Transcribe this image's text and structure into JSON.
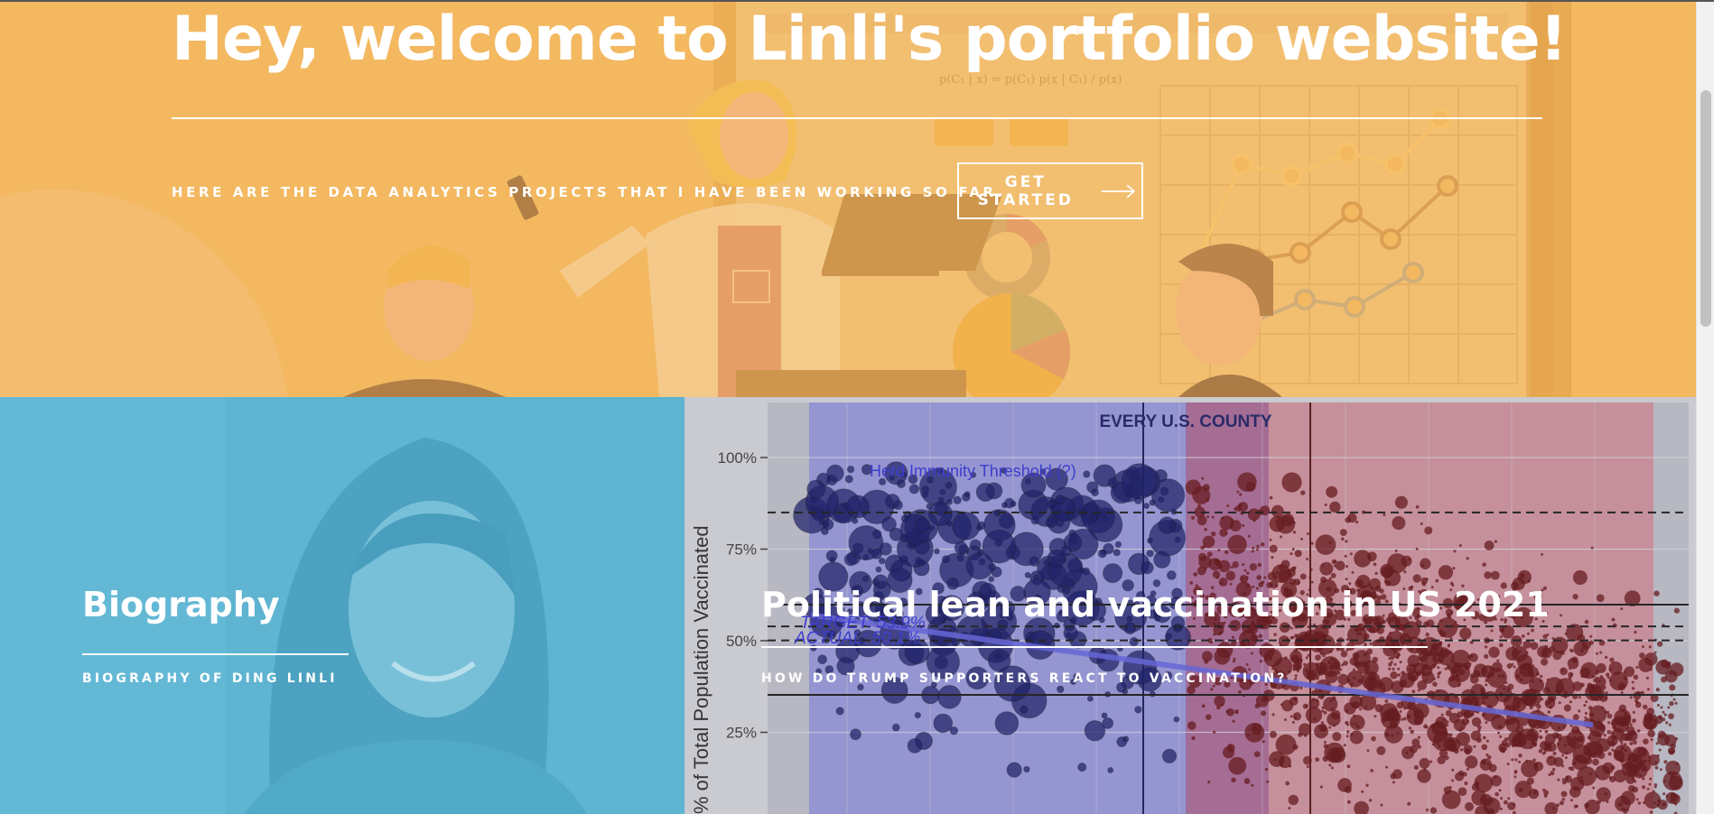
{
  "hero": {
    "title": "Hey, welcome to Linli's portfolio website!",
    "subtitle": "HERE ARE THE DATA ANALYTICS PROJECTS THAT I HAVE BEEN WORKING SO FAR.",
    "cta_label": "GET STARTED",
    "formula_text": "p(C₁ | x) = p(C₁) p(x | C₁) / p(x)",
    "bg_color": "#f2b860"
  },
  "tiles": [
    {
      "title": "Biography",
      "subtitle": "BIOGRAPHY OF DING LINLI",
      "overlay_color": "#5fb4d2"
    },
    {
      "title": "Political lean and vaccination in US 2021",
      "subtitle": "HOW DO TRUMP SUPPORTERS REACT TO VACCINATION?",
      "overlay_color": "#c9c9d0"
    }
  ],
  "chart_data": {
    "type": "scatter",
    "title": "EVERY U.S. COUNTY",
    "ylabel": "% of Total Population Vaccinated",
    "yticks": [
      "100%",
      "75%",
      "50%",
      "25%"
    ],
    "ylim": [
      0,
      100
    ],
    "annotations": {
      "herd_immunity": "Herd Immunity Threshold (?)",
      "target": "TARGET: 53.9%",
      "actual": "ACTUAL: 50.1%"
    },
    "reference_lines": {
      "herd_immunity_y": 85,
      "target_y": 53.9,
      "actual_y": 50.1
    },
    "trend": {
      "y_start": 57,
      "y_end": 27
    },
    "colors": {
      "dem": "#0a0c5a",
      "rep": "#5a0608",
      "dem_region": "#8b8bd4",
      "rep_region": "#c7848f",
      "trend": "#5a5ad8",
      "text": "#2b2bd0"
    }
  }
}
